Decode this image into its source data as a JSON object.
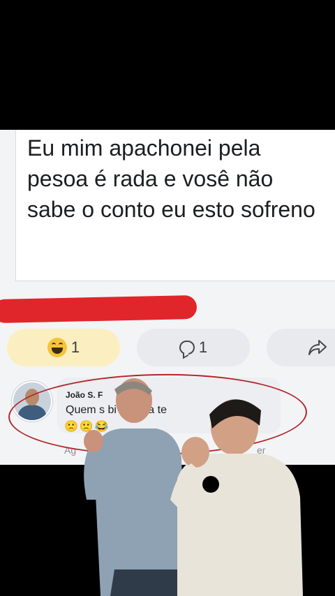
{
  "post": {
    "text": "Eu mim apachonei pela pesoa é rada e vosê não sabe o conto eu esto sofreno"
  },
  "reactions": {
    "laugh_count": "1",
    "comment_count": "1",
    "laugh_icon": "laughing-emoji-icon",
    "comment_icon": "comment-icon",
    "share_icon": "share-icon"
  },
  "comment": {
    "author": "João S. F",
    "text": "Quem s        bi eu, pra te",
    "emojis": "🙁🙁😂",
    "action_left": "Ag",
    "action_right": "er"
  },
  "colors": {
    "highlight_red": "#e0262a",
    "circle_red": "#b3262a",
    "like_pill_bg": "#fbefc2",
    "pill_bg": "#e9eaee"
  }
}
